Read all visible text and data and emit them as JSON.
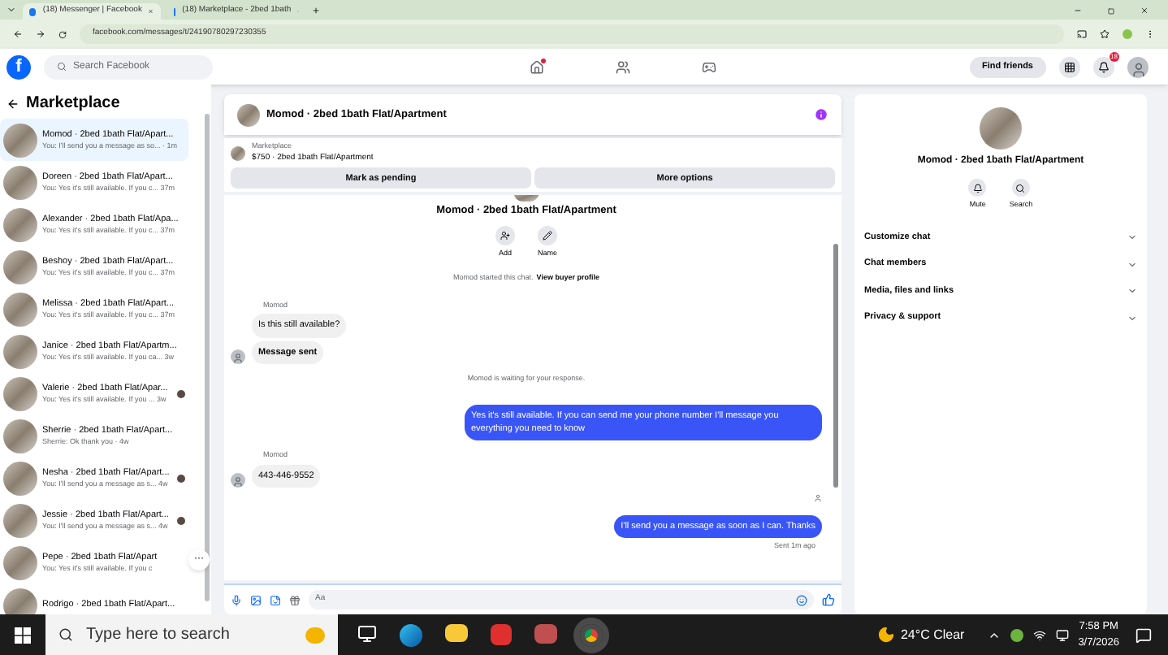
{
  "browser": {
    "tabs": [
      {
        "title": "(18) Messenger | Facebook",
        "selected": true
      },
      {
        "title": "(18) Marketplace - 2bed 1bath",
        "selected": false
      }
    ],
    "url": "facebook.com/messages/t/24190780297230355"
  },
  "header": {
    "logo": "f",
    "search_placeholder": "Search Facebook",
    "home_dot": true,
    "find_friends": "Find friends",
    "notification_count": "18"
  },
  "sidebar": {
    "title": "Marketplace",
    "conversations": [
      {
        "name": "Momod · 2bed 1bath Flat/Apart...",
        "preview": "You: I'll send you a message as so...",
        "time": "· 1m",
        "selected": true,
        "seen_avatar": false
      },
      {
        "name": "Doreen · 2bed 1bath Flat/Apart...",
        "preview": "You: Yes it's still available. If you c...",
        "time": "37m",
        "selected": false,
        "seen_avatar": false
      },
      {
        "name": "Alexander · 2bed 1bath Flat/Apa...",
        "preview": "You: Yes it's still available. If you c...",
        "time": "37m",
        "selected": false,
        "seen_avatar": false
      },
      {
        "name": "Beshoy · 2bed 1bath Flat/Apart...",
        "preview": "You: Yes it's still available. If you c...",
        "time": "37m",
        "selected": false,
        "seen_avatar": false
      },
      {
        "name": "Melissa · 2bed 1bath Flat/Apart...",
        "preview": "You: Yes it's still available. If you c...",
        "time": "37m",
        "selected": false,
        "seen_avatar": false
      },
      {
        "name": "Janice · 2bed 1bath Flat/Apartm...",
        "preview": "You: Yes it's still available. If you ca...",
        "time": "3w",
        "selected": false,
        "seen_avatar": false
      },
      {
        "name": "Valerie · 2bed 1bath Flat/Apar...",
        "preview": "You: Yes it's still available. If you ...",
        "time": "3w",
        "selected": false,
        "seen_avatar": true
      },
      {
        "name": "Sherrie · 2bed 1bath Flat/Apart...",
        "preview": "Sherrie: Ok thank you · 4w",
        "selected": false,
        "seen_avatar": false
      },
      {
        "name": "Nesha · 2bed 1bath Flat/Apart...",
        "preview": "You: I'll send you a message as s...",
        "time": "4w",
        "selected": false,
        "seen_avatar": true
      },
      {
        "name": "Jessie · 2bed 1bath Flat/Apart...",
        "preview": "You: I'll send you a message as s...",
        "time": "4w",
        "selected": false,
        "seen_avatar": true
      },
      {
        "name": "Pepe · 2bed 1bath Flat/Apart",
        "preview": "You: Yes it's still available. If you c",
        "selected": false,
        "seen_avatar": false
      },
      {
        "name": "Rodrigo · 2bed 1bath Flat/Apart...",
        "selected": false,
        "seen_avatar": false
      }
    ],
    "more_button": "···"
  },
  "chat": {
    "title": "Momod · 2bed 1bath Flat/Apartment",
    "listing": {
      "label": "Marketplace",
      "item": "$750 · 2bed 1bath Flat/Apartment"
    },
    "buttons": [
      "Mark as pending",
      "More options"
    ],
    "intro": {
      "name": "Momod · 2bed 1bath Flat/Apartment",
      "actions": [
        "Add",
        "Name"
      ]
    },
    "messages": [
      {
        "kind": "notice",
        "text": "Momod started this chat.",
        "link": "View buyer profile"
      },
      {
        "kind": "sender",
        "text": "Momod"
      },
      {
        "kind": "incoming",
        "text": "Is this still available?",
        "avatar": false,
        "bold": false
      },
      {
        "kind": "incoming",
        "text": "Message sent",
        "avatar": true,
        "bold": true
      },
      {
        "kind": "notice",
        "text": "Momod is waiting for your response."
      },
      {
        "kind": "outgoing",
        "text": "Yes it's still available. If you can send me your phone number I'll message you everything you need to know"
      },
      {
        "kind": "sender",
        "text": "Momod"
      },
      {
        "kind": "incoming",
        "text": "443-446-9552",
        "avatar": true,
        "bold": false
      },
      {
        "kind": "seen"
      },
      {
        "kind": "outgoing",
        "text": "I'll send you a message as soon as I can. Thanks"
      },
      {
        "kind": "status",
        "text": "Sent 1m ago"
      }
    ],
    "composer_placeholder": "Aa"
  },
  "info": {
    "name": "Momod · 2bed 1bath Flat/Apartment",
    "actions": [
      "Mute",
      "Search"
    ],
    "sections": [
      "Customize chat",
      "Chat members",
      "Media, files and links",
      "Privacy & support"
    ]
  },
  "taskbar": {
    "search_placeholder": "Type here to search",
    "weather": "24°C Clear",
    "time": "7:58 PM",
    "date": "3/7/2026"
  }
}
